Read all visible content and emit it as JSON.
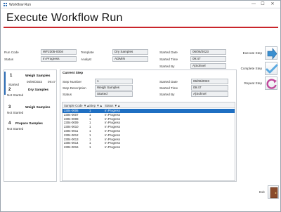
{
  "window": {
    "title": "Workflow Run",
    "min": "—",
    "max": "☐",
    "close": "✕"
  },
  "page": {
    "title": "Execute Workflow Run"
  },
  "header": {
    "run_code_label": "Run Code",
    "run_code": "WF2305-0004",
    "status_label": "Status",
    "status": "In Progress",
    "template_label": "Template",
    "template": "Dry Samples",
    "analyst_label": "Analyst",
    "analyst": "ADMIN",
    "started_date_label": "Started Date",
    "started_date": "06/06/2023",
    "started_time_label": "Started Time",
    "started_time": "09:47",
    "started_by_label": "Started By",
    "started_by": "A|Sohnel"
  },
  "steps": [
    {
      "num": "1",
      "name": "Weigh Samples",
      "status": "Started",
      "date": "06/06/2023",
      "time": "09:47"
    },
    {
      "num": "2",
      "name": "Dry Samples",
      "status": "Not Started",
      "date": "",
      "time": ""
    },
    {
      "num": "3",
      "name": "Weigh Samples",
      "status": "Not Started",
      "date": "",
      "time": ""
    },
    {
      "num": "4",
      "name": "Prepare Samples",
      "status": "Not Started",
      "date": "",
      "time": ""
    }
  ],
  "current_step": {
    "heading": "Current Step",
    "step_number_label": "Step Number",
    "step_number": "1",
    "step_desc_label": "Step Description",
    "step_desc": "Weigh Samples",
    "status_label": "Status",
    "status": "Started",
    "started_date_label": "Started Date",
    "started_date": "06/06/2023",
    "started_time_label": "Started Time",
    "started_time": "09:47",
    "started_by_label": "Started By",
    "started_by": "A|Sohnel"
  },
  "grid": {
    "columns": [
      "Sample Code ▼▲",
      "Step ▼▲",
      "Status ▼▲"
    ],
    "rows": [
      [
        "2304-0006",
        "1",
        "In Progress"
      ],
      [
        "2304-0007",
        "1",
        "In Progress"
      ],
      [
        "2304-0008",
        "1",
        "In Progress"
      ],
      [
        "2304-0009",
        "1",
        "In Progress"
      ],
      [
        "2304-0010",
        "1",
        "In Progress"
      ],
      [
        "2304-0011",
        "1",
        "In Progress"
      ],
      [
        "2304-0012",
        "1",
        "In Progress"
      ],
      [
        "2304-0013",
        "1",
        "In Progress"
      ],
      [
        "2304-0014",
        "1",
        "In Progress"
      ],
      [
        "2304-0016",
        "1",
        "In Progress"
      ]
    ],
    "selected_row": 0
  },
  "actions": {
    "execute": "Execute Step",
    "complete": "Complete Step",
    "repeat": "Repeat Step",
    "exit": "Exit"
  },
  "colors": {
    "accent": "#c9252b",
    "selection": "#1f6fc2",
    "execute_icon": "#3a8fd0",
    "complete_icon": "#5aa9e0",
    "repeat_icon": "#c0479a",
    "exit_icon": "#8a4b2c"
  }
}
